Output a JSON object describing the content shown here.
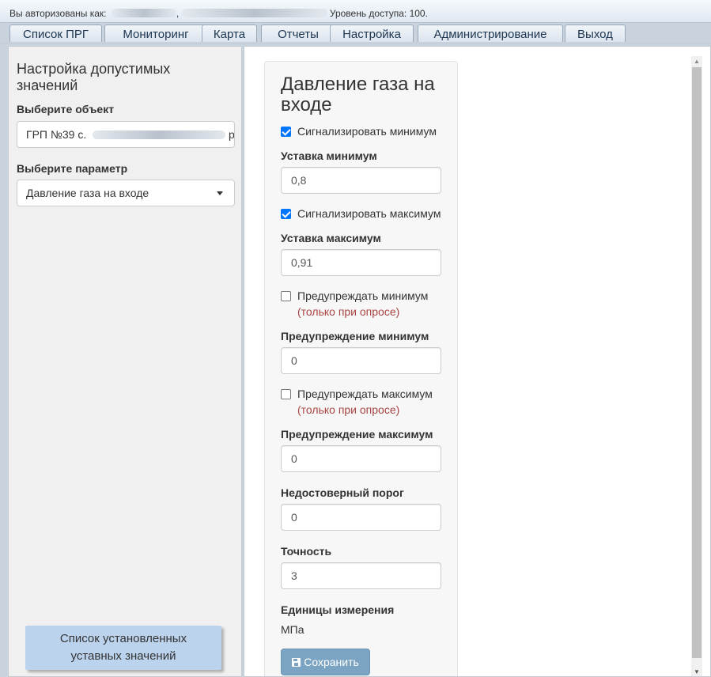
{
  "header": {
    "auth_prefix": "Вы авторизованы как:",
    "access_text": "Уровень доступа: 100."
  },
  "tabs": [
    {
      "label": "Список ПРГ"
    },
    {
      "label": "Мониторинг"
    },
    {
      "label": "Карта"
    },
    {
      "label": "Отчеты"
    },
    {
      "label": "Настройка"
    },
    {
      "label": "Администрирование"
    },
    {
      "label": "Выход"
    }
  ],
  "sidebar": {
    "title": "Настройка допустимых значений",
    "object_label": "Выберите объект",
    "object_value": "ГРП №39 с.",
    "object_value_tail": "р",
    "param_label": "Выберите параметр",
    "param_value": "Давление газа на входе",
    "list_button": "Список установленных уставных значений"
  },
  "form": {
    "title": "Давление газа на входе",
    "signal_min": {
      "label": "Сигнализировать минимум",
      "checked": true
    },
    "setpoint_min": {
      "label": "Уставка минимум",
      "value": "0,8"
    },
    "signal_max": {
      "label": "Сигнализировать максимум",
      "checked": true
    },
    "setpoint_max": {
      "label": "Уставка максимум",
      "value": "0,91"
    },
    "warn_min_check": {
      "label": "Предупреждать минимум",
      "note": "(только при опросе)",
      "checked": false
    },
    "warn_min": {
      "label": "Предупреждение минимум",
      "value": "0"
    },
    "warn_max_check": {
      "label": "Предупреждать максимум",
      "note": "(только при опросе)",
      "checked": false
    },
    "warn_max": {
      "label": "Предупреждение максимум",
      "value": "0"
    },
    "unreliable": {
      "label": "Недостоверный порог",
      "value": "0"
    },
    "precision": {
      "label": "Точность",
      "value": "3"
    },
    "units": {
      "label": "Единицы измерения",
      "value": "МПа"
    },
    "save_label": "Сохранить"
  },
  "colors": {
    "accent": "#7aa4c2",
    "checkbox": "#0075ff",
    "note": "#a94442",
    "list_button_bg": "#bcd3ee"
  }
}
